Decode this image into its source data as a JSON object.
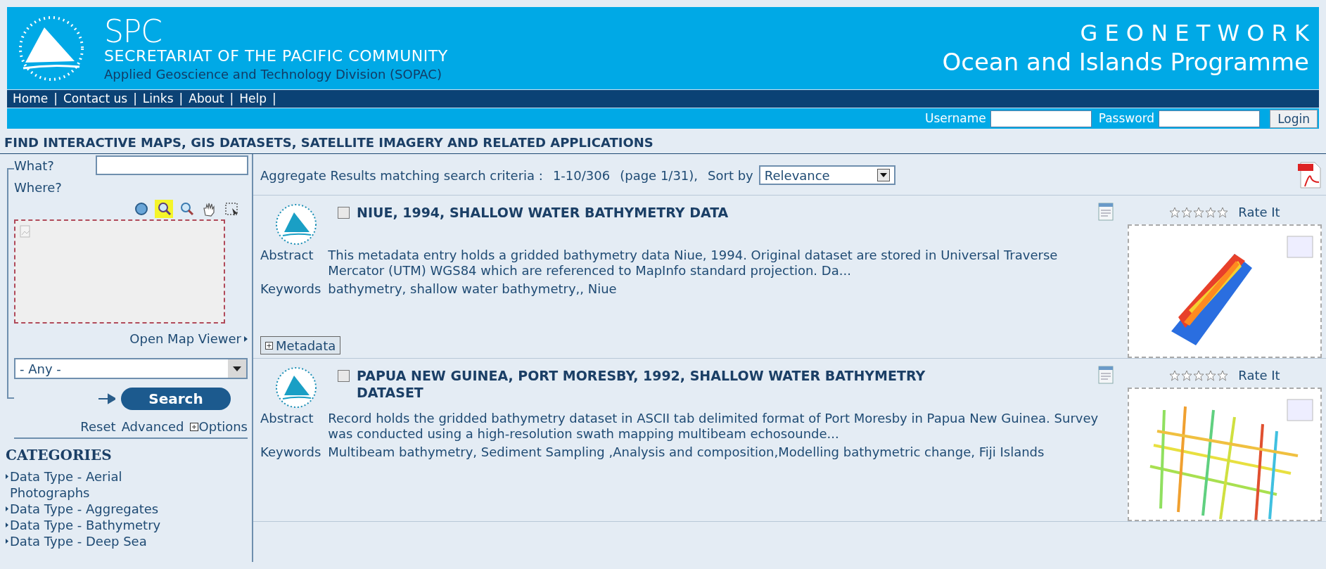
{
  "header": {
    "org_short": "SPC",
    "org_name": "SECRETARIAT OF THE PACIFIC COMMUNITY",
    "division": "Applied Geoscience and Technology Division (SOPAC)",
    "brand": "G E O N E T W O R K",
    "programme": "Ocean and Islands Programme"
  },
  "nav": {
    "separator": "|",
    "items": [
      "Home",
      "Contact us",
      "Links",
      "About",
      "Help"
    ]
  },
  "login": {
    "username_label": "Username",
    "password_label": "Password",
    "button": "Login"
  },
  "page_heading": "FIND INTERACTIVE MAPS, GIS DATASETS, SATELLITE IMAGERY AND RELATED APPLICATIONS",
  "search": {
    "what_label": "What?",
    "where_label": "Where?",
    "map_tools": [
      {
        "kind": "globe",
        "selected": false
      },
      {
        "kind": "zoom-in",
        "selected": true
      },
      {
        "kind": "zoom-out",
        "selected": false
      },
      {
        "kind": "pan",
        "selected": false
      },
      {
        "kind": "select",
        "selected": false
      }
    ],
    "open_map_viewer": "Open Map Viewer",
    "region": "- Any -",
    "search_button": "Search",
    "links": [
      "Reset",
      "Advanced",
      "Options"
    ]
  },
  "categories": {
    "title": "CATEGORIES",
    "items": [
      "Data Type - Aerial Photographs",
      "Data Type - Aggregates",
      "Data Type - Bathymetry",
      "Data Type - Deep Sea"
    ]
  },
  "results": {
    "summary": "Aggregate Results matching search criteria :",
    "range": "1-10/306",
    "page": "(page 1/31),",
    "sort_label": "Sort by",
    "sort_value": "Relevance",
    "records": [
      {
        "title": "NIUE, 1994, SHALLOW WATER BATHYMETRY DATA",
        "checked": false,
        "stars": 0,
        "rate": "Rate It",
        "abstract_label": "Abstract",
        "abstract": "This metadata entry holds a gridded bathymetry data Niue, 1994. Original dataset are stored in Universal Traverse Mercator (UTM) WGS84 which are referenced to MapInfo standard projection. Da...",
        "keywords_label": "Keywords",
        "keywords": "bathymetry, shallow water bathymetry,, Niue",
        "kind": "band",
        "metadata_button": "Metadata"
      },
      {
        "title": "PAPUA NEW GUINEA, PORT MORESBY, 1992, SHALLOW WATER BATHYMETRY DATASET",
        "checked": false,
        "stars": 0,
        "rate": "Rate It",
        "abstract_label": "Abstract",
        "abstract": "Record holds the gridded bathymetry dataset in ASCII tab delimited format of Port Moresby in Papua New Guinea. Survey was conducted using a high-resolution swath mapping multibeam echosounde...",
        "keywords_label": "Keywords",
        "keywords": "Multibeam bathymetry, Sediment Sampling ,Analysis and composition,Modelling bathymetric change, Fiji Islands",
        "kind": "lines"
      }
    ]
  }
}
